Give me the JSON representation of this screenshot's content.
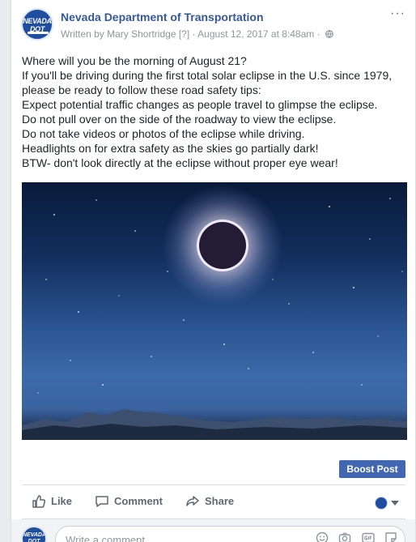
{
  "post": {
    "page_name": "Nevada Department of Transportation",
    "avatar_text": "NEVADA DOT",
    "meta": "Written by Mary Shortridge [?] · August 12, 2017 at 8:48am ·",
    "privacy_icon": "globe-icon",
    "more_label": "···",
    "text_lines": [
      "Where will you be the morning of August 21?",
      "If you'll be driving during the first total solar eclipse in the U.S. since 1979,",
      "please be ready to follow these road safety tips:",
      "Expect potential traffic changes as people travel to glimpse the eclipse.",
      "Do not pull over on the side of the roadway to view the eclipse.",
      "Do not take videos or photos of the eclipse while driving.",
      "Headlights on for extra safety as the skies go partially dark!",
      "BTW- don't look directly at the eclipse without proper eye wear!"
    ]
  },
  "boost": {
    "label": "Boost Post"
  },
  "actions": {
    "like": "Like",
    "comment": "Comment",
    "share": "Share"
  },
  "comment_box": {
    "placeholder": "Write a comment...",
    "icons": [
      "emoji-icon",
      "camera-icon",
      "gif-icon",
      "sticker-icon"
    ]
  },
  "colors": {
    "brand_blue": "#365899",
    "button_blue": "#4267b2",
    "meta_gray": "#90949c"
  }
}
